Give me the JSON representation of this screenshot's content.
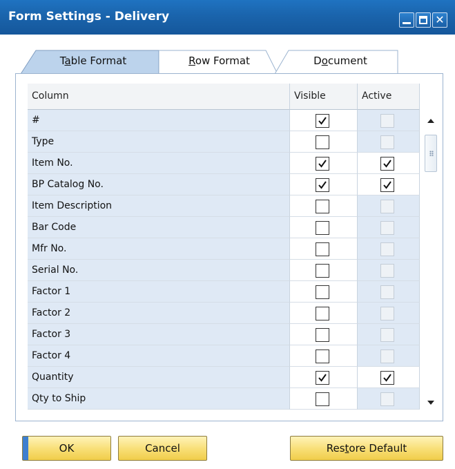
{
  "window": {
    "title": "Form Settings - Delivery"
  },
  "tabs": [
    {
      "pre": "T",
      "u": "a",
      "post": "ble Format",
      "active": true
    },
    {
      "pre": "",
      "u": "R",
      "post": "ow Format",
      "active": false
    },
    {
      "pre": "D",
      "u": "o",
      "post": "cument",
      "active": false
    }
  ],
  "grid": {
    "headers": {
      "column": "Column",
      "visible": "Visible",
      "active": "Active"
    },
    "rows": [
      {
        "name": "#",
        "visible": true,
        "active": false,
        "active_enabled": false
      },
      {
        "name": "Type",
        "visible": false,
        "active": false,
        "active_enabled": false
      },
      {
        "name": "Item No.",
        "visible": true,
        "active": true,
        "active_enabled": true
      },
      {
        "name": "BP Catalog No.",
        "visible": true,
        "active": true,
        "active_enabled": true
      },
      {
        "name": "Item Description",
        "visible": false,
        "active": false,
        "active_enabled": false
      },
      {
        "name": "Bar Code",
        "visible": false,
        "active": false,
        "active_enabled": false
      },
      {
        "name": "Mfr No.",
        "visible": false,
        "active": false,
        "active_enabled": false
      },
      {
        "name": "Serial No.",
        "visible": false,
        "active": false,
        "active_enabled": false
      },
      {
        "name": "Factor 1",
        "visible": false,
        "active": false,
        "active_enabled": false
      },
      {
        "name": "Factor 2",
        "visible": false,
        "active": false,
        "active_enabled": false
      },
      {
        "name": "Factor 3",
        "visible": false,
        "active": false,
        "active_enabled": false
      },
      {
        "name": "Factor 4",
        "visible": false,
        "active": false,
        "active_enabled": false
      },
      {
        "name": "Quantity",
        "visible": true,
        "active": true,
        "active_enabled": true
      },
      {
        "name": "Qty to Ship",
        "visible": false,
        "active": false,
        "active_enabled": false
      }
    ]
  },
  "buttons": {
    "ok": "OK",
    "cancel": "Cancel",
    "restore_pre": "Res",
    "restore_u": "t",
    "restore_post": "ore Default"
  },
  "colors": {
    "titlebar": "#1a64ac",
    "row_bg": "#dfe9f5",
    "button_yellow": "#f8de74"
  },
  "icons": [
    "minimize-icon",
    "maximize-icon",
    "close-icon",
    "scroll-up-arrow-icon",
    "scroll-down-arrow-icon",
    "checkmark-icon"
  ]
}
